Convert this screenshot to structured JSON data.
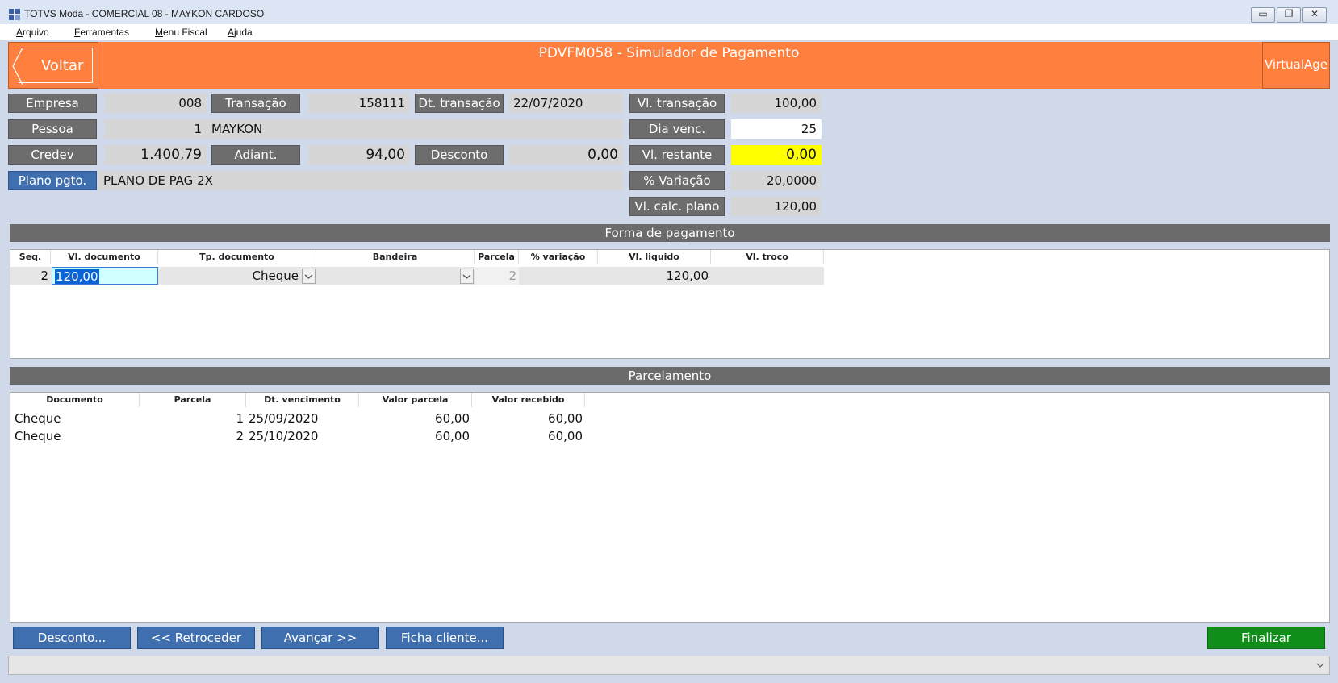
{
  "window": {
    "title": "TOTVS Moda - COMERCIAL 08 - MAYKON CARDOSO",
    "minimize": "▭",
    "maximize": "❐",
    "close": "✕"
  },
  "menu": {
    "items": [
      "Arquivo",
      "Ferramentas",
      "Menu Fiscal",
      "Ajuda"
    ]
  },
  "header": {
    "back_label": "Voltar",
    "title": "PDVFM058 - Simulador de Pagamento",
    "brand": "VirtualAge"
  },
  "form": {
    "empresa_label": "Empresa",
    "empresa_value": "008",
    "transacao_label": "Transação",
    "transacao_value": "158111",
    "dt_transacao_label": "Dt. transação",
    "dt_transacao_value": "22/07/2020",
    "vl_transacao_label": "Vl. transação",
    "vl_transacao_value": "100,00",
    "pessoa_label": "Pessoa",
    "pessoa_code": "1",
    "pessoa_name": "MAYKON",
    "dia_venc_label": "Dia venc.",
    "dia_venc_value": "25",
    "credev_label": "Credev",
    "credev_value": "1.400,79",
    "adiant_label": "Adiant.",
    "adiant_value": "94,00",
    "desconto_label": "Desconto",
    "desconto_value": "0,00",
    "vl_restante_label": "Vl. restante",
    "vl_restante_value": "0,00",
    "plano_label": "Plano pgto.",
    "plano_value": "PLANO DE PAG 2X",
    "variacao_label": "% Variação",
    "variacao_value": "20,0000",
    "vl_calc_label": "Vl. calc. plano",
    "vl_calc_value": "120,00"
  },
  "forma_pagamento": {
    "title": "Forma de pagamento",
    "columns": [
      "Seq.",
      "Vl. documento",
      "Tp. documento",
      "Bandeira",
      "Parcela",
      "% variação",
      "Vl. liquido",
      "Vl. troco"
    ],
    "row": {
      "seq": "2",
      "vl_documento": "120,00",
      "tp_documento": "Cheque",
      "bandeira": "",
      "parcela": "2",
      "variacao": "",
      "vl_liquido": "120,00",
      "vl_troco": ""
    }
  },
  "parcelamento": {
    "title": "Parcelamento",
    "columns": [
      "Documento",
      "Parcela",
      "Dt. vencimento",
      "Valor parcela",
      "Valor recebido"
    ],
    "rows": [
      {
        "documento": "Cheque",
        "parcela": "1",
        "dt_vencimento": "25/09/2020",
        "valor_parcela": "60,00",
        "valor_recebido": "60,00"
      },
      {
        "documento": "Cheque",
        "parcela": "2",
        "dt_vencimento": "25/10/2020",
        "valor_parcela": "60,00",
        "valor_recebido": "60,00"
      }
    ]
  },
  "actions": {
    "desconto": "Desconto...",
    "retroceder": "<< Retroceder",
    "avancar": "Avançar >>",
    "ficha_cliente": "Ficha cliente...",
    "finalizar": "Finalizar"
  },
  "colors": {
    "header": "#ff7f3f",
    "button_gray": "#6d6d6d",
    "button_blue": "#3f6fae",
    "button_green": "#118e1a",
    "highlight_yellow": "#ffff00"
  }
}
